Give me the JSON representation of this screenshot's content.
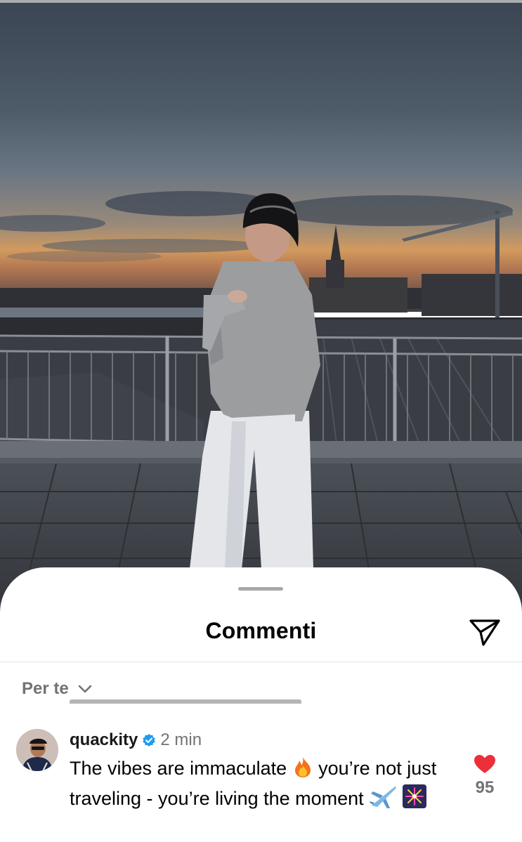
{
  "sheet": {
    "title": "Commenti",
    "filter_label": "Per te",
    "share_icon": "paper-plane-icon",
    "filter_icon": "chevron-down-icon"
  },
  "comment": {
    "username": "quackity",
    "verified_icon": "verified-badge-icon",
    "time": "2 min",
    "text_parts": [
      "The vibes are immaculate ",
      " you’re not just traveling - you’re living the moment "
    ],
    "emoji_icons": [
      "fire-icon",
      "airplane-icon",
      "fireworks-icon"
    ],
    "like_count": "95",
    "like_icon": "heart-filled-icon"
  },
  "colors": {
    "accent_like": "#ed2f3a",
    "verified_blue": "#1f9bf0",
    "secondary_text": "#737373"
  }
}
